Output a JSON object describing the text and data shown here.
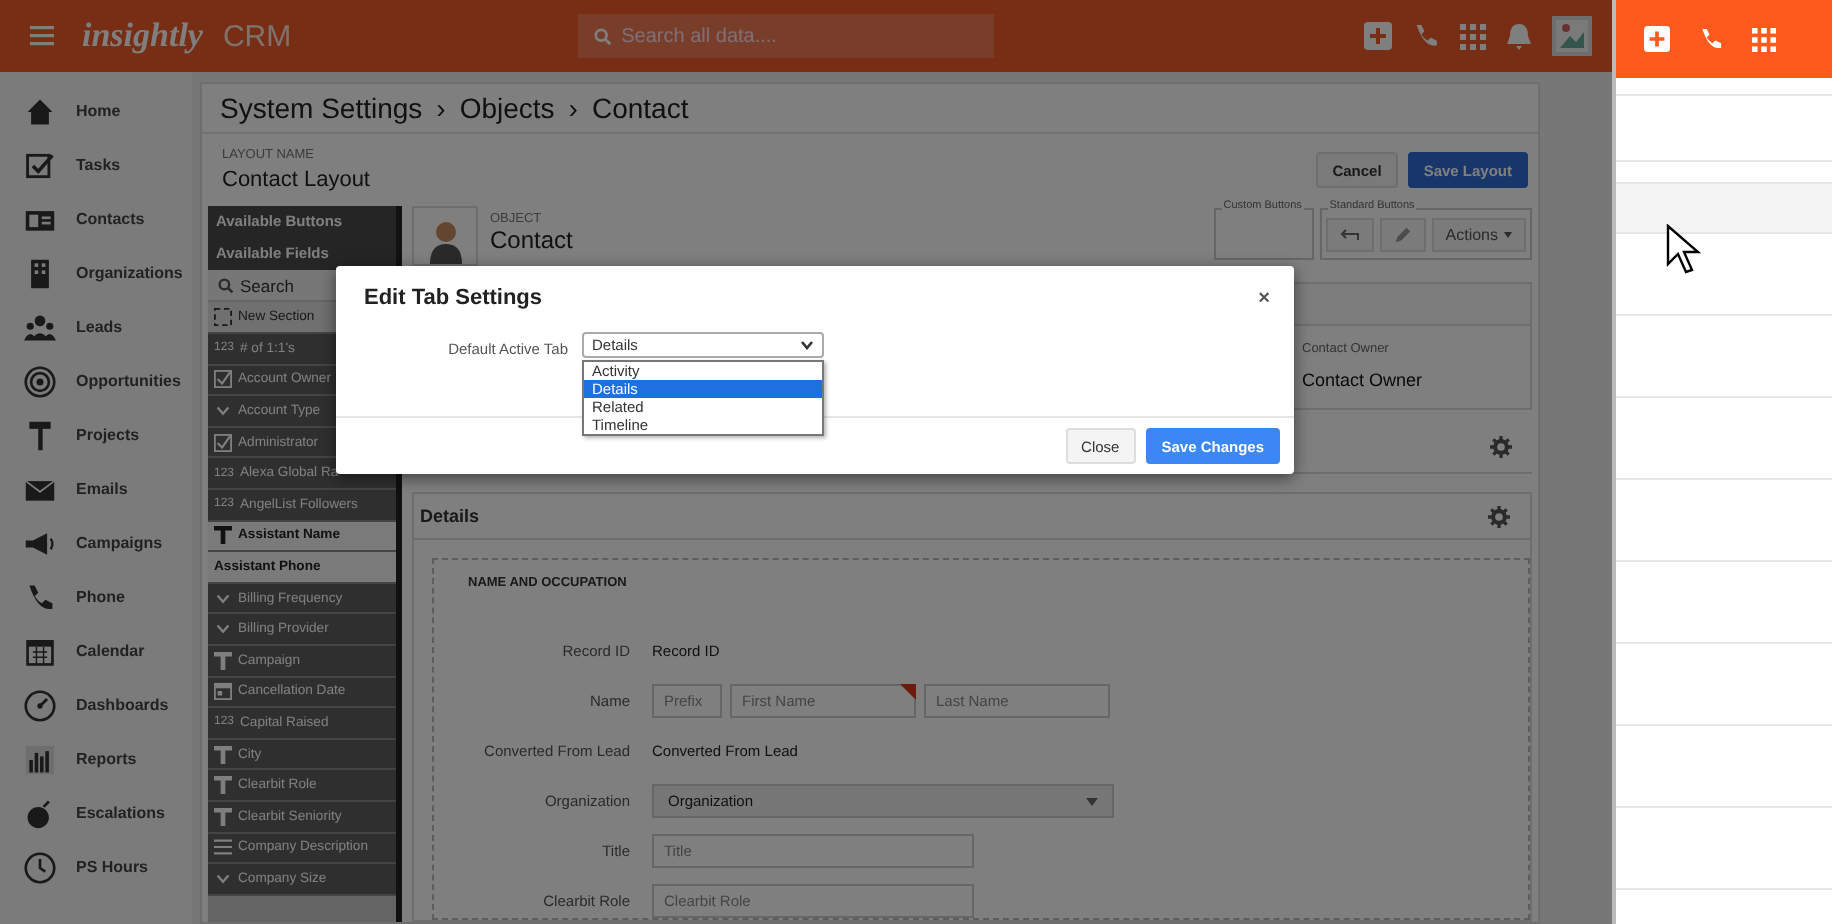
{
  "topbar": {
    "brand": "insightly",
    "product": "CRM",
    "search": {
      "placeholder": "Search all data...."
    }
  },
  "sidebar": {
    "items": [
      {
        "label": "Home"
      },
      {
        "label": "Tasks"
      },
      {
        "label": "Contacts"
      },
      {
        "label": "Organizations"
      },
      {
        "label": "Leads"
      },
      {
        "label": "Opportunities"
      },
      {
        "label": "Projects"
      },
      {
        "label": "Emails"
      },
      {
        "label": "Campaigns"
      },
      {
        "label": "Phone"
      },
      {
        "label": "Calendar"
      },
      {
        "label": "Dashboards"
      },
      {
        "label": "Reports"
      },
      {
        "label": "Escalations"
      },
      {
        "label": "PS Hours"
      }
    ]
  },
  "breadcrumb": {
    "items": [
      "System Settings",
      "Objects",
      "Contact"
    ],
    "separator": "›"
  },
  "layout": {
    "label": "LAYOUT NAME",
    "name": "Contact Layout",
    "buttons": [
      {
        "label": "Cancel",
        "kind": "default"
      },
      {
        "label": "Save Layout",
        "kind": "primary"
      }
    ]
  },
  "palette": {
    "buttons_header": "Available Buttons",
    "fields_header": "Available Fields",
    "search": {
      "placeholder": "Search"
    },
    "new_section": "New Section",
    "fields": [
      {
        "label": "# of 1:1's",
        "kind": "number",
        "icon_text": "123",
        "disabled": true
      },
      {
        "label": "Account Owner",
        "kind": "checkbox",
        "disabled": true
      },
      {
        "label": "Account Type",
        "kind": "dropdown",
        "disabled": true
      },
      {
        "label": "Administrator",
        "kind": "checkbox",
        "disabled": true
      },
      {
        "label": "Alexa Global Ra",
        "kind": "number",
        "icon_text": "123",
        "disabled": true
      },
      {
        "label": "AngelList Followers",
        "kind": "number",
        "icon_text": "123",
        "disabled": true
      },
      {
        "label": "Assistant Name",
        "kind": "text",
        "disabled": false
      },
      {
        "label": "Assistant Phone",
        "kind": "plain",
        "disabled": false
      },
      {
        "label": "Billing Frequency",
        "kind": "dropdown",
        "disabled": true
      },
      {
        "label": "Billing Provider",
        "kind": "dropdown",
        "disabled": true
      },
      {
        "label": "Campaign",
        "kind": "text",
        "disabled": true
      },
      {
        "label": "Cancellation Date",
        "kind": "date",
        "disabled": true
      },
      {
        "label": "Capital Raised",
        "kind": "number",
        "icon_text": "123",
        "disabled": true
      },
      {
        "label": "City",
        "kind": "text",
        "disabled": true
      },
      {
        "label": "Clearbit Role",
        "kind": "text",
        "disabled": true
      },
      {
        "label": "Clearbit Seniority",
        "kind": "text",
        "disabled": true
      },
      {
        "label": "Company Description",
        "kind": "textarea",
        "disabled": true
      },
      {
        "label": "Company Size",
        "kind": "dropdown",
        "disabled": true
      }
    ]
  },
  "object": {
    "label": "OBJECT",
    "name": "Contact",
    "custom_buttons": {
      "legend": "Custom Buttons"
    },
    "standard_buttons": {
      "legend": "Standard Buttons",
      "actions": "Actions"
    }
  },
  "owner": {
    "label": "Contact Owner",
    "value": "Contact Owner"
  },
  "details": {
    "title": "Details",
    "section": "NAME AND OCCUPATION",
    "rows": [
      {
        "label": "Record ID",
        "kind": "static",
        "value": "Record ID"
      },
      {
        "label": "Name",
        "kind": "name",
        "inputs": [
          {
            "placeholder": "Prefix",
            "required": false
          },
          {
            "placeholder": "First Name",
            "required": true
          },
          {
            "placeholder": "Last Name",
            "required": false
          }
        ]
      },
      {
        "label": "Converted From Lead",
        "kind": "static",
        "value": "Converted From Lead"
      },
      {
        "label": "Organization",
        "kind": "select",
        "value": "Organization"
      },
      {
        "label": "Title",
        "kind": "input",
        "placeholder": "Title"
      },
      {
        "label": "Clearbit Role",
        "kind": "input",
        "placeholder": "Clearbit Role"
      }
    ]
  },
  "modal": {
    "title": "Edit Tab Settings",
    "close": "×",
    "field_label": "Default Active Tab",
    "value": "Details",
    "options": [
      {
        "label": "Activity",
        "selected": false
      },
      {
        "label": "Details",
        "selected": true
      },
      {
        "label": "Related",
        "selected": false
      },
      {
        "label": "Timeline",
        "selected": false
      }
    ],
    "buttons": [
      {
        "label": "Close",
        "kind": "default"
      },
      {
        "label": "Save Changes",
        "kind": "primary"
      }
    ]
  }
}
